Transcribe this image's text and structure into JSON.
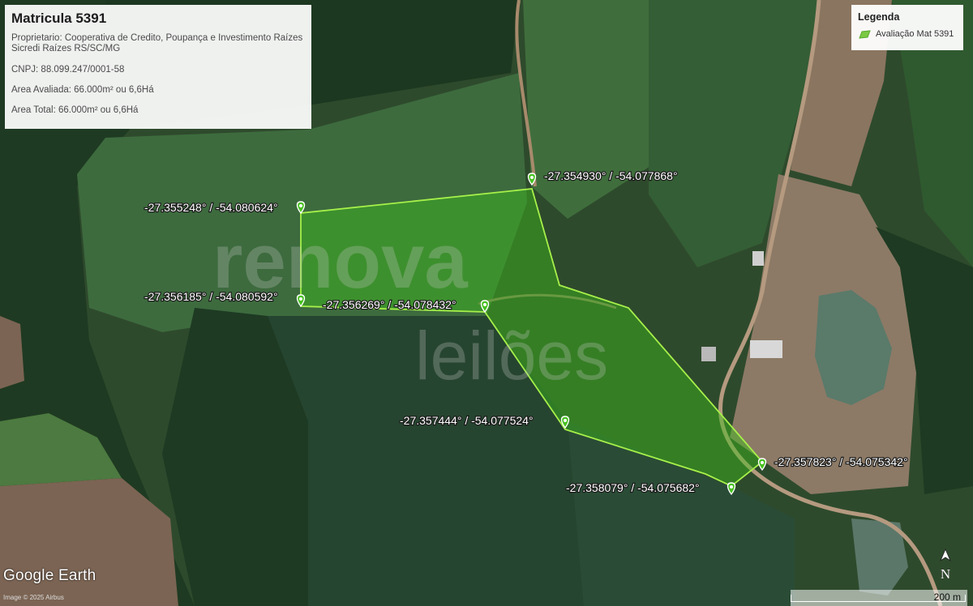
{
  "info": {
    "title": "Matricula 5391",
    "owner": "Proprietario: Cooperativa de Credito, Poupança e Investimento Raízes Sicredi Raízes RS/SC/MG",
    "cnpj": "CNPJ: 88.099.247/0001-58",
    "area_evaluated": "Area Avaliada: 66.000m² ou 6,6Há",
    "area_total": "Area Total: 66.000m² ou 6,6Há"
  },
  "legend": {
    "title": "Legenda",
    "item_label": "Avaliação Mat 5391",
    "swatch_color": "#7ac943"
  },
  "markers": [
    {
      "label": "-27.355248° / -54.080624°"
    },
    {
      "label": "-27.354930° / -54.077868°"
    },
    {
      "label": "-27.356185° / -54.080592°"
    },
    {
      "label": "-27.356269° / -54.078432°"
    },
    {
      "label": "-27.357444° / -54.077524°"
    },
    {
      "label": "-27.357823° / -54.075342°"
    },
    {
      "label": "-27.358079° / -54.075682°"
    }
  ],
  "watermark": {
    "line1": "renova",
    "line2": "leilões"
  },
  "branding": {
    "logo": "Google Earth",
    "copyright": "Image © 2025 Airbus"
  },
  "scale": {
    "label": "200 m"
  },
  "north": {
    "label": "N"
  },
  "colors": {
    "polygon_fill": "#3fbf1a",
    "polygon_stroke": "#a6f04a",
    "marker": "#47c21f"
  }
}
